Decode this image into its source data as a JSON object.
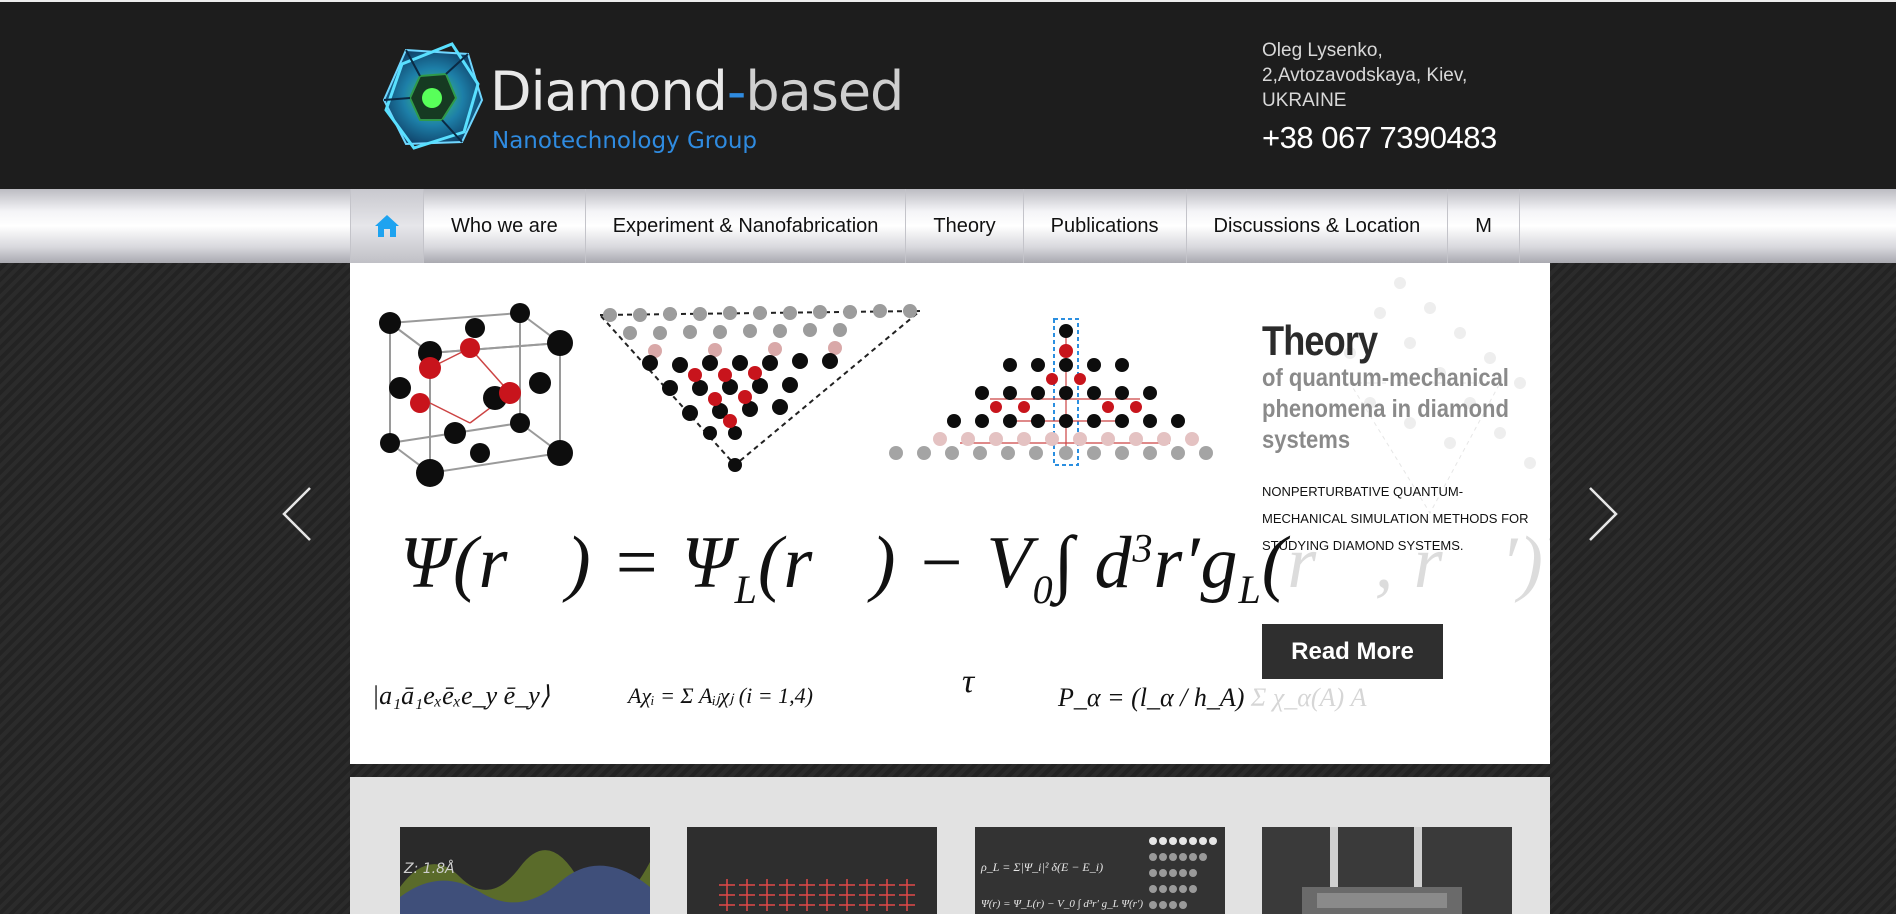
{
  "header": {
    "logo": {
      "title_main": "Diamond",
      "title_dash": "-",
      "title_based": "based",
      "subtitle": "Nanotechnology Group"
    },
    "contact": {
      "line1": "Oleg Lysenko,",
      "line2": "2,Avtozavodskaya, Kiev,",
      "line3": "UKRAINE",
      "phone": "+38 067 7390483"
    }
  },
  "nav": {
    "home_icon": "home-icon",
    "items": [
      {
        "label": "Who we are"
      },
      {
        "label": "Experiment & Nanofabrication"
      },
      {
        "label": "Theory"
      },
      {
        "label": "Publications"
      },
      {
        "label": "Discussions & Location"
      },
      {
        "label": "M"
      }
    ]
  },
  "slide": {
    "heading": "Theory",
    "subheading": "of quantum-mechanical phenomena in diamond systems",
    "text": "NONPERTURBATIVE QUANTUM-MECHANICAL SIMULATION METHODS FOR STUDYING DIAMOND SYSTEMS.",
    "button": "Read More",
    "formula_main": "Ψ(r⃗) = Ψ",
    "formula_sub_L": "L",
    "formula_mid": "(r⃗) − V",
    "formula_sub_0": "0",
    "formula_int": "∫ d",
    "formula_sup_3": "3",
    "formula_rest": "r′g",
    "formula_sub_L2": "L",
    "formula_paren": "(",
    "formula_faded": "r⃗, r⃗′)Ψ(r⃗′)",
    "formula_tau": "τ",
    "formula_ket": "|a₁ā₁eₓēₓe_y ē_y⟩",
    "formula_sum": "Aχᵢ = Σ Aᵢⱼχⱼ  (i = 1,4)",
    "formula_p": "P_α = (l_α / h_A)",
    "formula_p_faded": "Σ χ_α(A) A"
  },
  "controls": {
    "prev_icon": "chevron-left-icon",
    "next_icon": "chevron-right-icon"
  },
  "colors": {
    "header_bg": "#1d1d1d",
    "accent_blue": "#2f8be0",
    "button_bg": "#2f2f2f"
  }
}
